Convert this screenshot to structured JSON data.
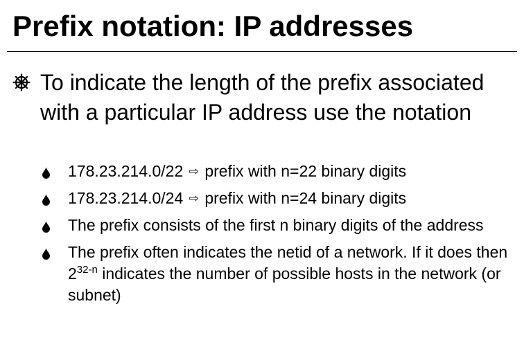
{
  "slide": {
    "title": "Prefix notation: IP addresses",
    "main_bullet": "To indicate the length of the prefix associated with a particular IP address use the notation",
    "sub_bullets": [
      {
        "address": "178.23.214.0/22",
        "arrow": "⇨",
        "description": "prefix with n=22 binary digits"
      },
      {
        "address": "178.23.214.0/24",
        "arrow": "⇨",
        "description": "prefix with n=24 binary digits"
      },
      {
        "text": "The prefix consists of the first n binary digits of the address"
      },
      {
        "text_before": "The prefix often indicates the netid of a network. If it does then 2",
        "superscript": "32-n",
        "text_after": " indicates the number of possible hosts in the network (or subnet)"
      }
    ]
  }
}
